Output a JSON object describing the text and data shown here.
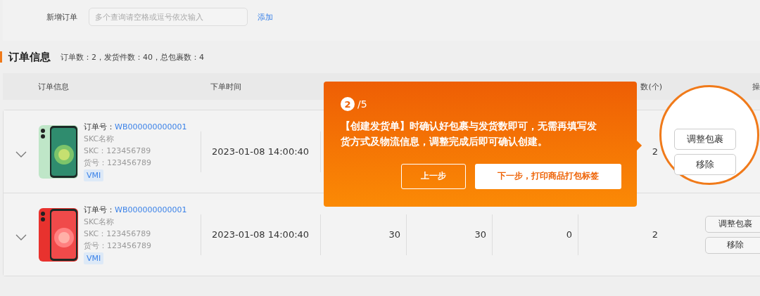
{
  "add_order": {
    "label": "新增订单",
    "placeholder": "多个查询请空格或逗号依次输入",
    "button": "添加"
  },
  "section": {
    "title": "订单信息",
    "summary": "订单数：2，发货件数：40，总包裹数：4"
  },
  "table": {
    "columns": [
      "订单信息",
      "下单时间",
      "",
      "",
      "",
      "数(个)",
      "操"
    ],
    "rows": [
      {
        "expanded": false,
        "order_label": "订单号：",
        "order_no": "WB000000000001",
        "skc_name": "SKC名称",
        "skc": "SKC：123456789",
        "sku": "货号：123456789",
        "tag": "VMI",
        "time": "2023-01-08 14:00:40",
        "cells": [
          "",
          "",
          "",
          "2"
        ],
        "actions": [
          "调整包裹",
          "移除"
        ],
        "highlighted": true
      },
      {
        "expanded": false,
        "order_label": "订单号：",
        "order_no": "WB000000000001",
        "skc_name": "SKC名称",
        "skc": "SKC：123456789",
        "sku": "货号：123456789",
        "tag": "VMI",
        "time": "2023-01-08 14:00:40",
        "cells": [
          "30",
          "30",
          "0",
          "2"
        ],
        "actions": [
          "调整包裹",
          "移除"
        ],
        "highlighted": false
      }
    ]
  },
  "guide": {
    "step": "2",
    "total": "/5",
    "text": "【创建发货单】时确认好包裹与发货数即可，无需再填写发货方式及物流信息，调整完成后即可确认创建。",
    "prev": "上一步",
    "next": "下一步，打印商品打包标签"
  }
}
